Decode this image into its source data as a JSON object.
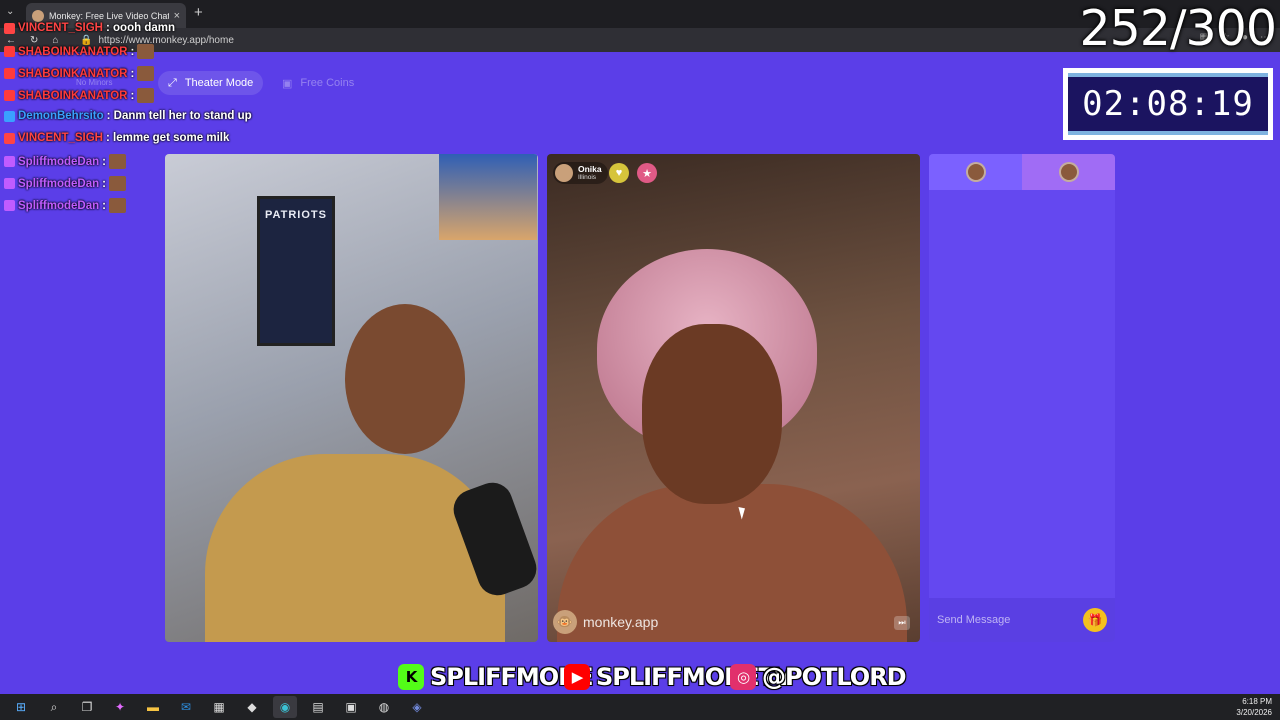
{
  "browser": {
    "tab_title": "Monkey: Free Live Video Chat",
    "tab_close": "×",
    "new_tab": "+",
    "url": "https://www.monkey.app/home"
  },
  "site": {
    "theater_mode": "Theater Mode",
    "free_coins": "Free Coins",
    "no_minors": "No Minors"
  },
  "stream_chat": [
    {
      "user": "VINCENT_SIGH",
      "text": ": oooh damn",
      "color": "#ff4444"
    },
    {
      "user": "SHABOINKANATOR",
      "text": ":",
      "color": "#ff3b3b"
    },
    {
      "user": "SHABOINKANATOR",
      "text": ":",
      "color": "#ff3b3b"
    },
    {
      "user": "SHABOINKANATOR",
      "text": ":",
      "color": "#ff3b3b"
    },
    {
      "user": "DemonBehrsito",
      "text": ": Danm tell her to stand up",
      "color": "#3aa0ff"
    },
    {
      "user": "VINCENT_SIGH",
      "text": ": lemme get some milk",
      "color": "#ff4444"
    },
    {
      "user": "SpliffmodeDan",
      "text": ":",
      "color": "#c05cff"
    },
    {
      "user": "SpliffmodeDan",
      "text": ":",
      "color": "#c05cff"
    },
    {
      "user": "SpliffmodeDan",
      "text": ":",
      "color": "#c05cff"
    }
  ],
  "left_video": {
    "poster_text": "PATRIOTS"
  },
  "right_video": {
    "partner_name": "Onika",
    "partner_location": "Illinois",
    "watermark": "monkey.app"
  },
  "side_panel": {
    "message_placeholder": "Send Message"
  },
  "overlay": {
    "counter": "252/300",
    "timer": "02:08:19"
  },
  "socials": [
    {
      "handle": "SPLIFFMODE",
      "icon": "kick-icon",
      "color": "#53fc18"
    },
    {
      "handle": "SPLIFFMODETV",
      "icon": "youtube-icon",
      "color": "#ff0000"
    },
    {
      "handle": "@POTLORD",
      "icon": "instagram-icon",
      "color": "#e1306c"
    }
  ],
  "taskbar": {
    "time": "6:18 PM",
    "date": "3/20/2026"
  },
  "colors": {
    "background": "#5b3ee8",
    "panel": "#6448f0",
    "timer_bg": "#1b1460"
  }
}
